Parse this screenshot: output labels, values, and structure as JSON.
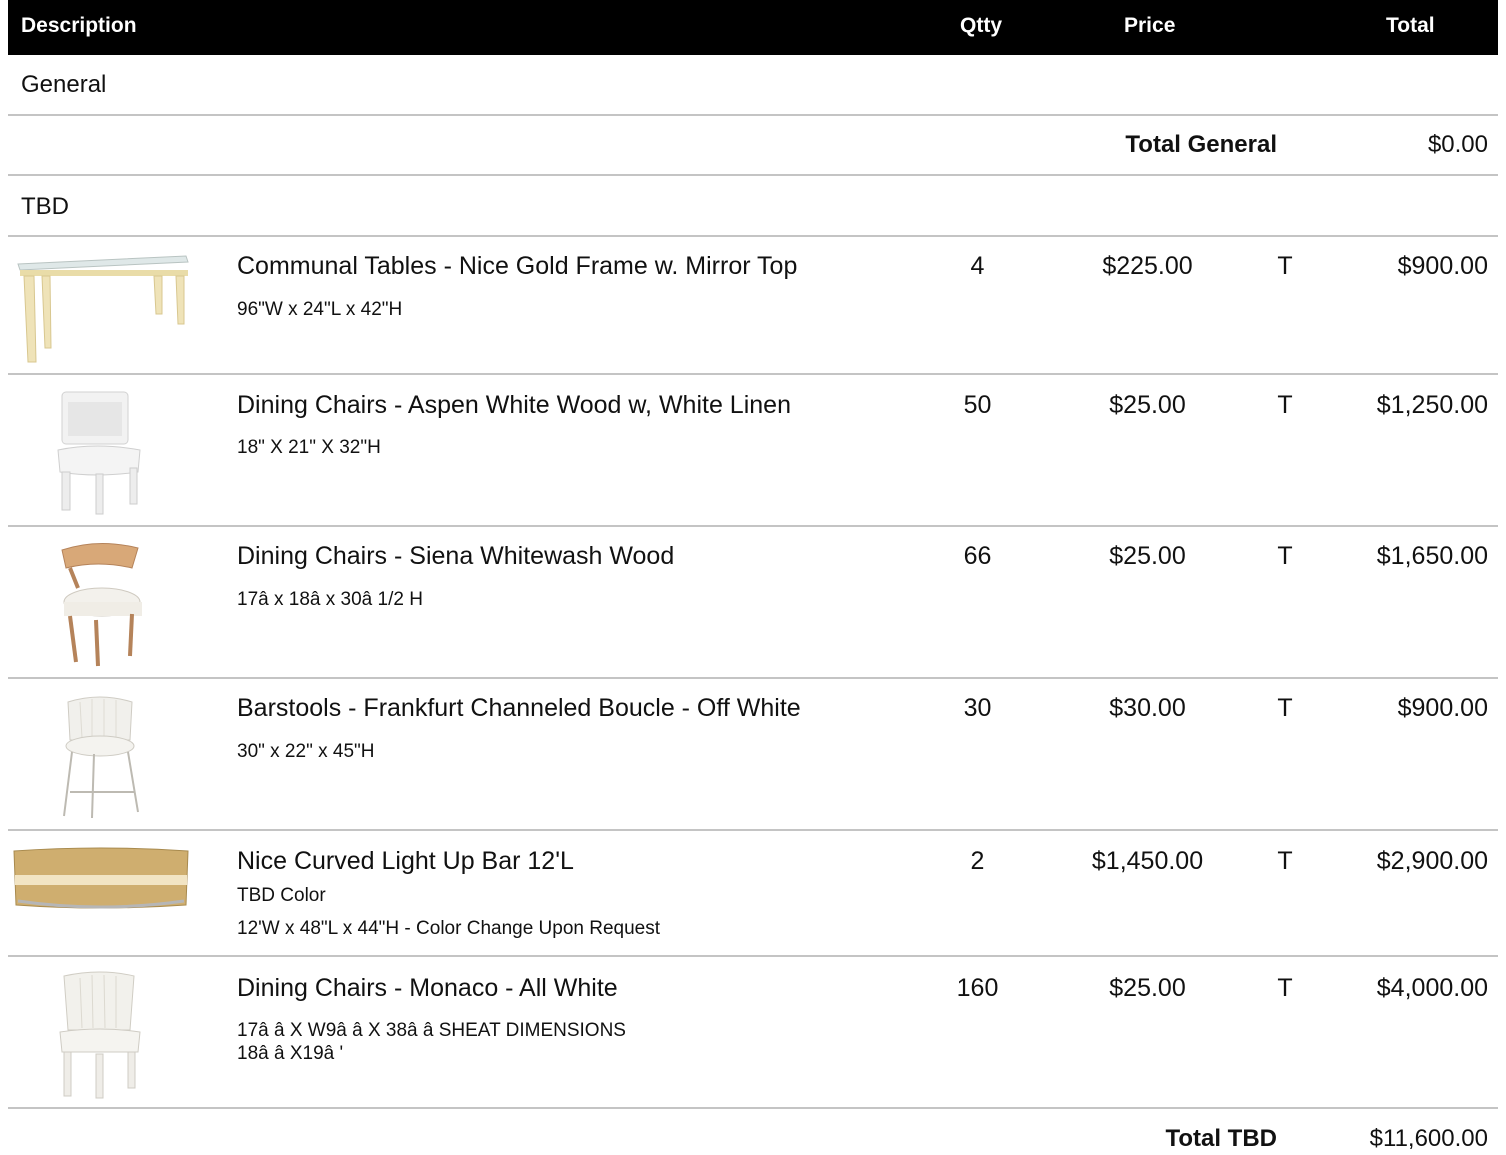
{
  "header": {
    "description": "Description",
    "qty": "Qtty",
    "price": "Price",
    "total": "Total"
  },
  "groups": [
    {
      "name": "General",
      "total_label": "Total General",
      "total_value": "$0.00"
    },
    {
      "name": "TBD",
      "total_label": "Total TBD",
      "total_value": "$11,600.00"
    }
  ],
  "items": [
    {
      "image": "gold-mirror-table-image",
      "name": "Communal Tables - Nice Gold Frame w. Mirror Top",
      "notes": [
        "96\"W x 24\"L x 42\"H"
      ],
      "qty": "4",
      "price": "$225.00",
      "tax": "T",
      "total": "$900.00"
    },
    {
      "image": "white-dining-chair-image",
      "name": "Dining Chairs - Aspen White Wood w, White Linen",
      "notes": [
        "18\" X 21\" X 32\"H"
      ],
      "qty": "50",
      "price": "$25.00",
      "tax": "T",
      "total": "$1,250.00"
    },
    {
      "image": "whitewash-wood-chair-image",
      "name": "Dining Chairs - Siena Whitewash Wood",
      "notes": [
        "17â x 18â x 30â 1/2 H"
      ],
      "qty": "66",
      "price": "$25.00",
      "tax": "T",
      "total": "$1,650.00"
    },
    {
      "image": "boucle-barstool-image",
      "name": "Barstools - Frankfurt Channeled Boucle - Off White",
      "notes": [
        "30\" x 22\" x 45\"H"
      ],
      "qty": "30",
      "price": "$30.00",
      "tax": "T",
      "total": "$900.00"
    },
    {
      "image": "curved-light-up-bar-image",
      "name": "Nice Curved Light Up Bar 12'L",
      "notes": [
        "TBD Color",
        "12'W x 48\"L x 44\"H - Color Change Upon Request"
      ],
      "qty": "2",
      "price": "$1,450.00",
      "tax": "T",
      "total": "$2,900.00"
    },
    {
      "image": "monaco-white-chair-image",
      "name": "Dining Chairs - Monaco - All White",
      "notes": [
        "17â  â X W9â  â X 38â  â SHEAT DIMENSIONS",
        "18â  â  X19â  '"
      ],
      "qty": "160",
      "price": "$25.00",
      "tax": "T",
      "total": "$4,000.00"
    }
  ]
}
